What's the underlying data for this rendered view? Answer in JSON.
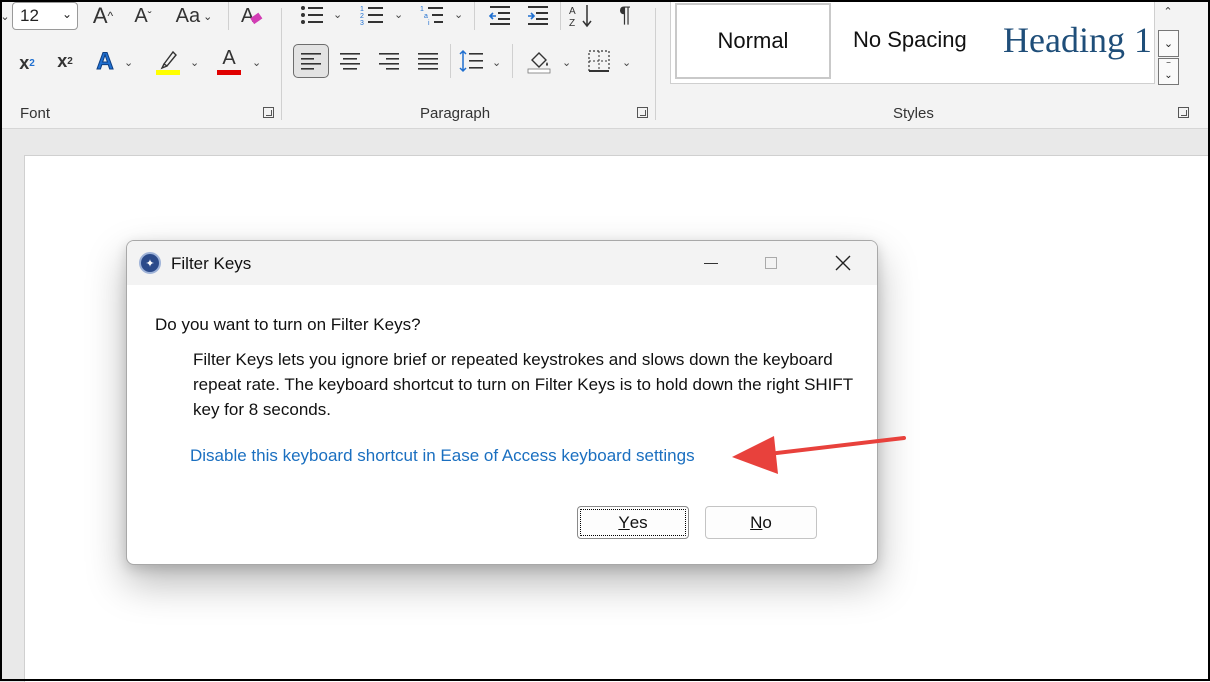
{
  "ribbon": {
    "font": {
      "size_value": "12",
      "group_label": "Font",
      "grow_glyph": "A",
      "shrink_glyph": "A",
      "case_glyph": "Aa",
      "subscript_glyph": "x",
      "subscript_mark": "2",
      "superscript_glyph": "x",
      "superscript_mark": "2",
      "text_effects_glyph": "A",
      "font_color_glyph": "A",
      "highlight_color": "#ffff00",
      "font_color": "#e00000"
    },
    "paragraph": {
      "group_label": "Paragraph",
      "sort_glyph": "A↓Z",
      "pilcrow_glyph": "¶"
    },
    "styles": {
      "group_label": "Styles",
      "normal": "Normal",
      "no_spacing": "No Spacing",
      "heading": "Heading 1"
    }
  },
  "dialog": {
    "title": "Filter Keys",
    "question": "Do you want to turn on Filter Keys?",
    "description": "Filter Keys lets you ignore brief or repeated keystrokes and slows down the keyboard repeat rate.  The keyboard shortcut to turn on Filter Keys is to hold down the right SHIFT key for 8 seconds.",
    "link": "Disable this keyboard shortcut in Ease of Access keyboard settings",
    "yes_mnemonic": "Y",
    "yes_rest": "es",
    "no_mnemonic": "N",
    "no_rest": "o",
    "link_color": "#1a6fc0"
  },
  "annotation": {
    "arrow_color": "#e8413c"
  }
}
